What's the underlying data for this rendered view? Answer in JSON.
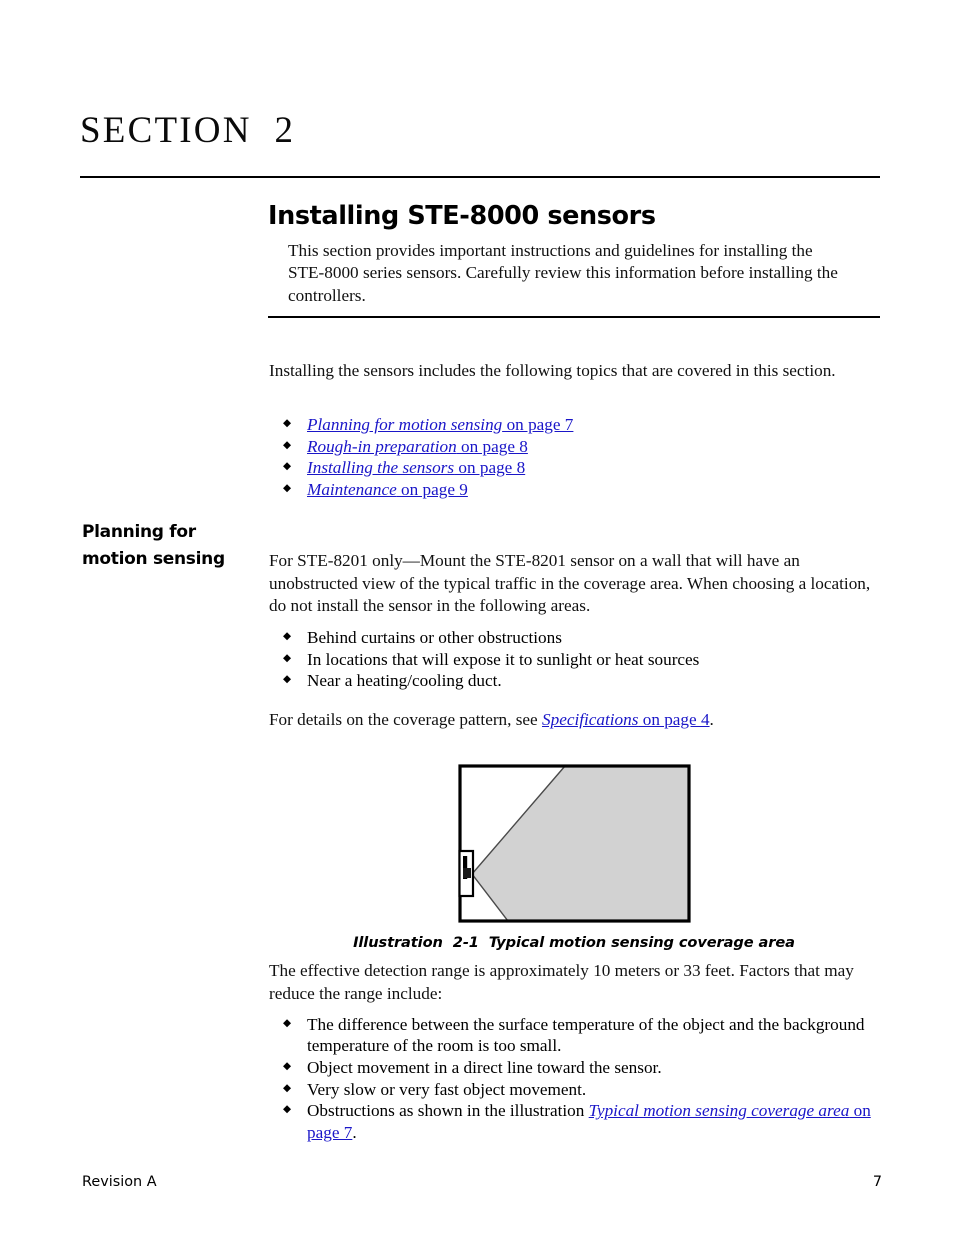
{
  "section": {
    "label": "SECTION  2"
  },
  "title": {
    "heading": "Installing STE-8000 sensors",
    "abstract": "This section provides important instructions and guidelines for installing the STE-8000 series sensors. Carefully review this information before installing the controllers."
  },
  "intro": {
    "paragraph": "Installing the sensors includes the following topics that are covered in this section."
  },
  "toc": {
    "items": [
      {
        "title": "Planning for motion sensing",
        "page_ref": " on page 7"
      },
      {
        "title": "Rough-in preparation",
        "page_ref": " on page 8"
      },
      {
        "title": "Installing the sensors",
        "page_ref": " on page 8"
      },
      {
        "title": "Maintenance",
        "page_ref": " on page 9"
      }
    ]
  },
  "planning": {
    "margin_heading": "Planning for motion sensing",
    "paragraph": "For STE-8201 only—Mount the STE-8201 sensor on a wall that will have an unobstructed view of the typical traffic in the coverage area. When choosing a location, do not install the sensor in the following areas.",
    "avoid_items": [
      "Behind curtains or other obstructions",
      "In locations that will expose it to sunlight or heat sources",
      "Near a heating/cooling duct."
    ],
    "coverage_ref_lead": "For details on the coverage pattern, see ",
    "coverage_ref_title": "Specifications",
    "coverage_ref_page": " on page 4",
    "coverage_ref_tail": "."
  },
  "illustration": {
    "caption": "Illustration  2-1  Typical motion sensing coverage area",
    "shape_fill": "#d2d2d2",
    "border_color": "#000000"
  },
  "range": {
    "paragraph": "The effective detection range is approximately 10 meters or 33 feet. Factors that may reduce the range include:",
    "factors": [
      {
        "text": "The difference between the surface temperature of the object and the background temperature of the room is too small."
      },
      {
        "text": "Object movement in a direct line toward the sensor."
      },
      {
        "text": "Very slow or very fast object movement."
      },
      {
        "text": "Obstructions as shown in the illustration ",
        "link_title": "Typical motion sensing coverage area",
        "link_page": " on page 7",
        "tail": "."
      }
    ]
  },
  "footer": {
    "revision": "Revision A",
    "page_number": "7"
  },
  "colors": {
    "link": "#1a16c8",
    "text": "#111111",
    "rule": "#000000"
  }
}
